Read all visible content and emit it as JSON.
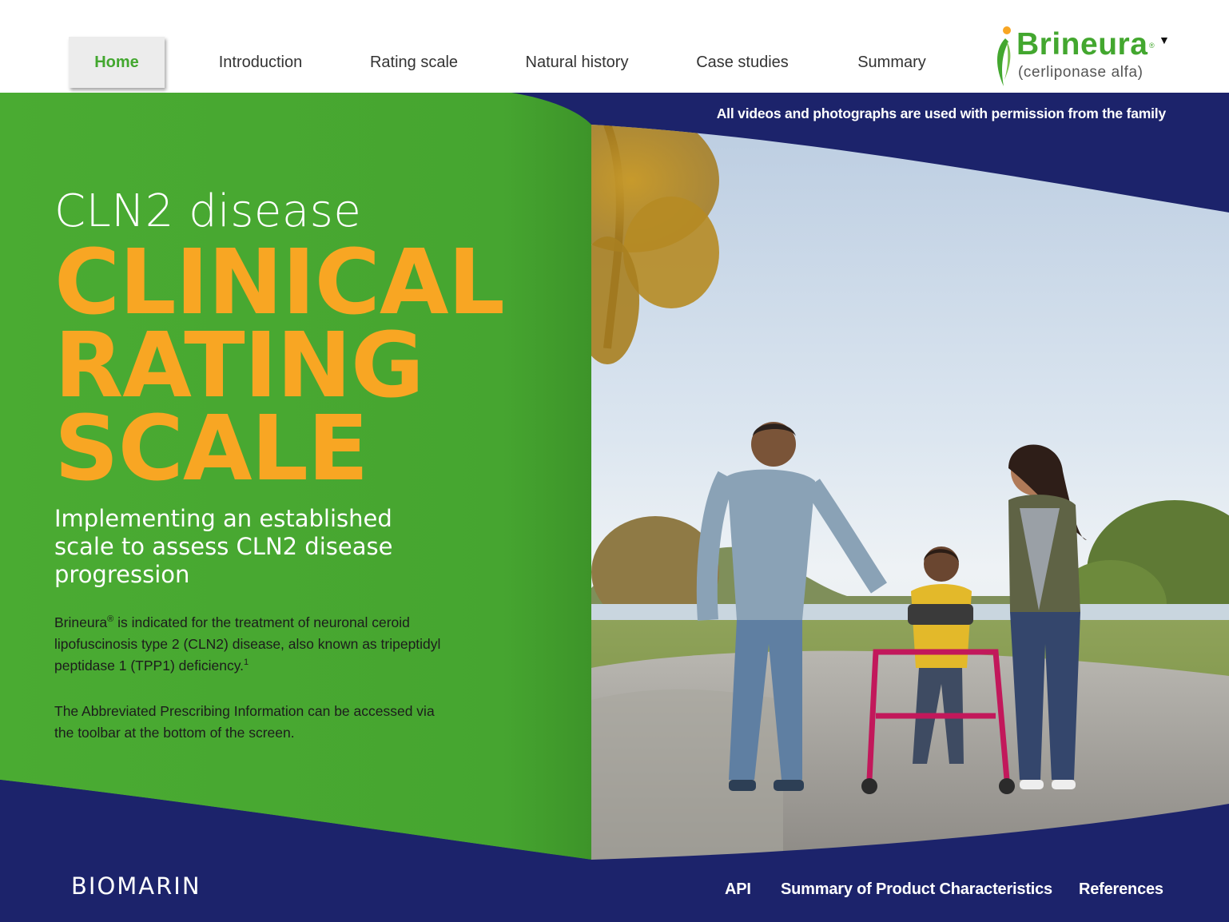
{
  "nav": {
    "items": [
      {
        "label": "Home",
        "active": true
      },
      {
        "label": "Introduction",
        "active": false
      },
      {
        "label": "Rating scale",
        "active": false
      },
      {
        "label": "Natural history",
        "active": false
      },
      {
        "label": "Case studies",
        "active": false
      },
      {
        "label": "Summary",
        "active": false
      }
    ]
  },
  "logo": {
    "name": "Brineura",
    "registered": "®",
    "subtitle": "(cerliponase alfa)",
    "menu_icon": "caret-down-icon"
  },
  "hero": {
    "permission_note": "All videos and photographs are used with permission from the family",
    "title": "CLN2 disease",
    "big_lines": [
      "CLINICAL",
      "RATING",
      "SCALE"
    ],
    "subtitle": "Implementing an established scale to assess CLN2 disease progression",
    "body": {
      "para1_brand": "Brineura",
      "para1_reg": "®",
      "para1_text": " is indicated for the treatment of neuronal ceroid lipofuscinosis type 2 (CLN2) disease, also known as tripeptidyl peptidase 1 (TPP1) deficiency.",
      "para1_ref": "1",
      "para2": "The Abbreviated Prescribing Information can be accessed via the toolbar at the bottom of the screen."
    },
    "photo_description_icon": "family-photo"
  },
  "footer": {
    "brand": "BIOMARIN",
    "links": [
      "API",
      "Summary of Product Characteristics",
      "References"
    ]
  },
  "colors": {
    "green": "#43a72f",
    "navy": "#1c236b",
    "orange": "#f8a623",
    "nav_active_bg": "#ececec"
  }
}
